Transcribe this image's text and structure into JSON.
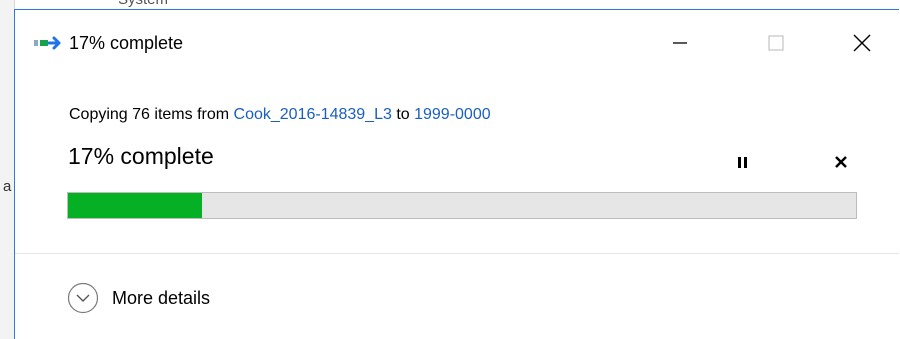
{
  "background": {
    "peek_text": "System",
    "peek_char": "a"
  },
  "window": {
    "title": "17% complete",
    "icon": "copy-transfer-icon",
    "controls": {
      "minimize": "minimize-icon",
      "maximize": "maximize-icon",
      "close": "close-icon"
    }
  },
  "copy": {
    "prefix": "Copying 76 items from ",
    "source": "Cook_2016-14839_L3",
    "middle": " to ",
    "destination": "1999-0000",
    "status": "17% complete",
    "progress_fraction": 0.17,
    "pause_icon": "pause-icon",
    "cancel_icon": "cancel-icon"
  },
  "details": {
    "label": "More details",
    "icon": "chevron-down-icon"
  },
  "colors": {
    "progress": "#06b025",
    "link": "#1a5fbf",
    "border": "#2b79d8"
  }
}
